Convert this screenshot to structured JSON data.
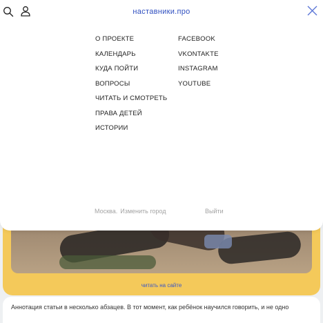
{
  "header": {
    "logo_text": "наставники.про",
    "icons": [
      "search-icon",
      "user-icon",
      "close-icon"
    ],
    "accent_color": "#2f4fc0"
  },
  "menu": {
    "main_items": [
      {
        "label": "О ПРОЕКТЕ"
      },
      {
        "label": "КАЛЕНДАРЬ"
      },
      {
        "label": "КУДА ПОЙТИ"
      },
      {
        "label": "ВОПРОСЫ"
      },
      {
        "label": "ЧИТАТЬ И СМОТРЕТЬ"
      },
      {
        "label": "ПРАВА ДЕТЕЙ"
      },
      {
        "label": "ИСТОРИИ"
      }
    ],
    "social_items": [
      {
        "label": "FACEBOOK"
      },
      {
        "label": "VKONTAKTE"
      },
      {
        "label": "INSTAGRAM"
      },
      {
        "label": "YOUTUBE"
      }
    ]
  },
  "footer": {
    "city": "Москва.",
    "change_city": "Изменить город",
    "logout": "Выйти"
  },
  "page": {
    "read_on_site": "читать на сайте",
    "annotation": "Аннотация статьи в несколько абзацев. В тот момент, как ребёнок научился говорить, и не одно"
  },
  "colors": {
    "card_yellow": "#f4c95a",
    "link_blue": "#3b57c6"
  }
}
